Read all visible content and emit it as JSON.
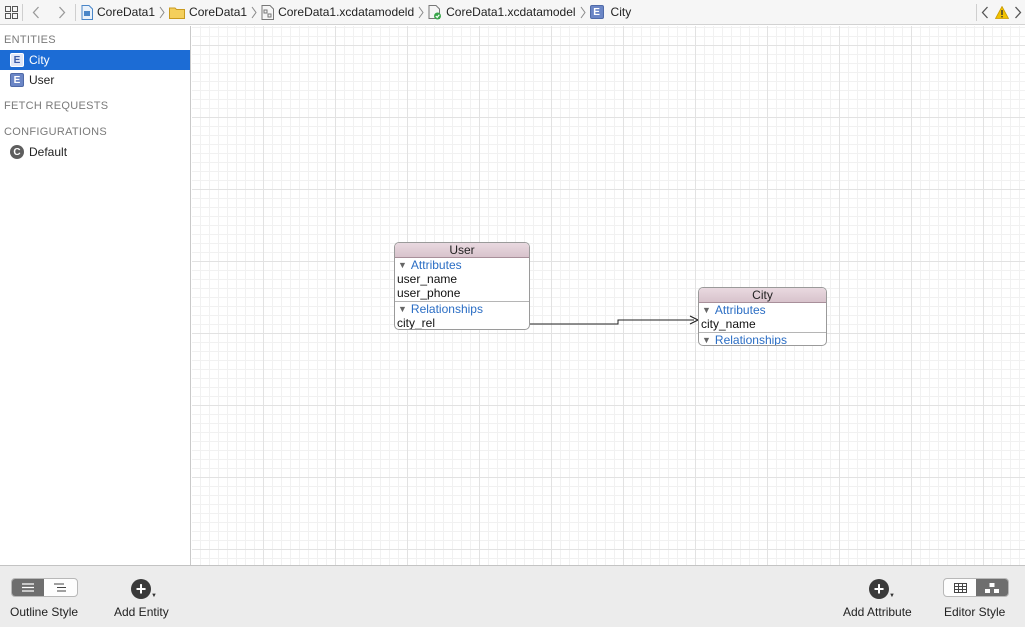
{
  "breadcrumbs": [
    {
      "label": "CoreData1",
      "icon": "project-file-icon"
    },
    {
      "label": "CoreData1",
      "icon": "folder-icon"
    },
    {
      "label": "CoreData1.xcdatamodeld",
      "icon": "model-bundle-icon"
    },
    {
      "label": "CoreData1.xcdatamodel",
      "icon": "data-model-icon"
    },
    {
      "label": "City",
      "icon": "entity-icon"
    }
  ],
  "sidebar": {
    "entities_header": "ENTITIES",
    "entities": [
      {
        "badge": "E",
        "label": "City",
        "selected": true
      },
      {
        "badge": "E",
        "label": "User",
        "selected": false
      }
    ],
    "fetch_header": "FETCH REQUESTS",
    "config_header": "CONFIGURATIONS",
    "configurations": [
      {
        "badge": "C",
        "label": "Default"
      }
    ]
  },
  "diagram": {
    "user": {
      "title": "User",
      "attributes_label": "Attributes",
      "attributes": [
        "user_name",
        "user_phone"
      ],
      "relationships_label": "Relationships",
      "relationships": [
        "city_rel"
      ]
    },
    "city": {
      "title": "City",
      "attributes_label": "Attributes",
      "attributes": [
        "city_name"
      ],
      "relationships_label": "Relationships",
      "relationships": []
    }
  },
  "bottombar": {
    "outline_style_label": "Outline Style",
    "add_entity_label": "Add Entity",
    "add_attribute_label": "Add Attribute",
    "editor_style_label": "Editor Style",
    "add_symbol": "+"
  },
  "colors": {
    "selection": "#1c6cd5",
    "entity_header": "#e0cdd5",
    "section_label": "#2a6dc4",
    "warning": "#f2c200"
  }
}
